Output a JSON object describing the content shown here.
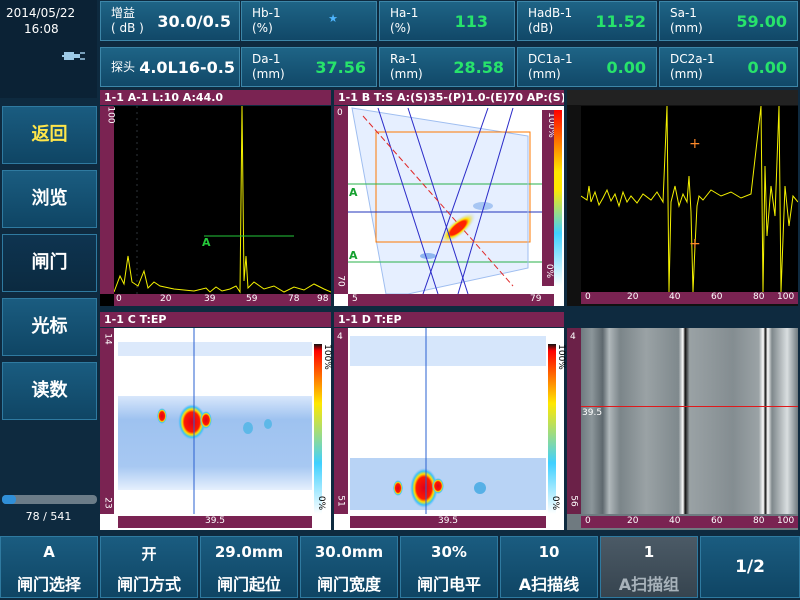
{
  "status": {
    "date": "2014/05/22",
    "time": "16:08",
    "probe_icon": "probe-connector-icon"
  },
  "top_cells": {
    "gain": {
      "label1": "增益",
      "label2": "( dB )",
      "value": "30.0/0.5"
    },
    "probe": {
      "label": "探头",
      "value": "4.0L16-0.5"
    },
    "hb1": {
      "label1": "Hb-1",
      "label2": "(%)",
      "value": "★"
    },
    "da1": {
      "label1": "Da-1",
      "label2": "(mm)",
      "value": "37.56"
    },
    "ha1": {
      "label1": "Ha-1",
      "label2": "(%)",
      "value": "113"
    },
    "ra1": {
      "label1": "Ra-1",
      "label2": "(mm)",
      "value": "28.58"
    },
    "hadb1": {
      "label1": "HadB-1",
      "label2": "(dB)",
      "value": "11.52"
    },
    "dc1a": {
      "label1": "DC1a-1",
      "label2": "(mm)",
      "value": "0.00"
    },
    "sa1": {
      "label1": "Sa-1",
      "label2": "(mm)",
      "value": "59.00"
    },
    "dc2a": {
      "label1": "DC2a-1",
      "label2": "(mm)",
      "value": "0.00"
    }
  },
  "menu": {
    "items": [
      "返回",
      "浏览",
      "闸门",
      "光标",
      "读数"
    ],
    "progress_text": "78 / 541",
    "progress": 0.144
  },
  "panels": {
    "a_scan": {
      "title": "1-1 A-1   L:10 A:44.0",
      "gate_label": "A",
      "x_ticks": [
        "0",
        "20",
        "39",
        "59",
        "78",
        "98"
      ],
      "y_top": "100"
    },
    "s_scan": {
      "title": "1-1 B   T:S A:(S)35-(P)1.0-(E)70 AP:(S)",
      "x_ticks": [
        "5",
        "79"
      ],
      "gate_a1": "A",
      "gate_a2": "A",
      "pct_top": "100%",
      "pct_bot": "0%",
      "y_top": "0",
      "y_bot": "70"
    },
    "c_scan": {
      "title": "1-1 C    T:EP",
      "cursor": "39.5",
      "y_top": "14",
      "y_bot": "23",
      "pct_top": "100%",
      "pct_bot": "0%"
    },
    "d_scan": {
      "title": "1-1 D    T:EP",
      "cursor": "39.5",
      "y_top": "4",
      "y_bot": "51",
      "pct_top": "100%",
      "pct_bot": "0%"
    },
    "right_top": {
      "x_ticks": [
        "0",
        "20",
        "40",
        "60",
        "80",
        "100"
      ]
    },
    "right_bot": {
      "cursor": "39.5",
      "x_ticks": [
        "0",
        "20",
        "40",
        "60",
        "80",
        "100"
      ],
      "y_top": "4",
      "y_bot": "56"
    }
  },
  "bottom": {
    "buttons": [
      {
        "value": "A",
        "label": "闸门选择"
      },
      {
        "value": "开",
        "label": "闸门方式"
      },
      {
        "value": "29.0mm",
        "label": "闸门起位"
      },
      {
        "value": "30.0mm",
        "label": "闸门宽度"
      },
      {
        "value": "30%",
        "label": "闸门电平"
      },
      {
        "value": "10",
        "label": "A扫描线"
      },
      {
        "value": "1",
        "label": "A扫描组"
      }
    ],
    "page": "1/2"
  },
  "colors": {
    "bg": "#0e2a3f",
    "cell_value": "#27e36b",
    "title_bar": "#7a2352",
    "signal": "#f3f000"
  }
}
